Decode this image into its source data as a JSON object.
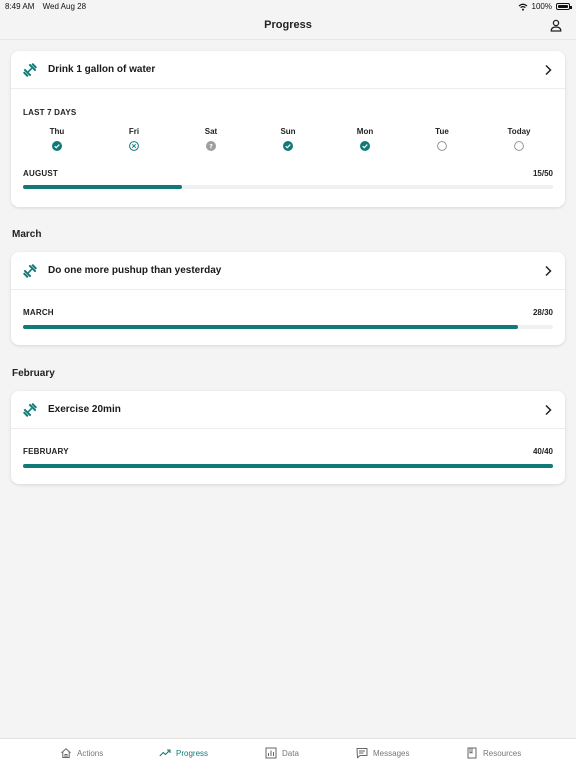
{
  "status_bar": {
    "time": "8:49 AM",
    "date": "Wed Aug 28",
    "battery": "100%"
  },
  "header": {
    "title": "Progress"
  },
  "colors": {
    "accent": "#117a78",
    "skipped": "#9e9e9e",
    "track": "#f0f0f0"
  },
  "current_goal": {
    "title": "Drink 1 gallon of water",
    "icon": "dumbbell-icon",
    "week_label": "LAST 7 DAYS",
    "days": [
      {
        "name": "Thu",
        "status": "complete"
      },
      {
        "name": "Fri",
        "status": "missed"
      },
      {
        "name": "Sat",
        "status": "skipped"
      },
      {
        "name": "Sun",
        "status": "complete"
      },
      {
        "name": "Mon",
        "status": "complete"
      },
      {
        "name": "Tue",
        "status": "pending"
      },
      {
        "name": "Today",
        "status": "pending"
      }
    ],
    "month": "AUGUST",
    "count": "15/50",
    "progress": 0.3
  },
  "sections": [
    {
      "label": "March",
      "goal": {
        "title": "Do one more pushup than yesterday",
        "icon": "dumbbell-icon",
        "month": "MARCH",
        "count": "28/30",
        "progress": 0.9333
      }
    },
    {
      "label": "February",
      "goal": {
        "title": "Exercise 20min",
        "icon": "dumbbell-icon",
        "month": "FEBRUARY",
        "count": "40/40",
        "progress": 1.0
      }
    }
  ],
  "tabs": [
    {
      "label": "Actions",
      "icon": "home-icon",
      "active": false
    },
    {
      "label": "Progress",
      "icon": "trend-icon",
      "active": true
    },
    {
      "label": "Data",
      "icon": "bar-chart-icon",
      "active": false
    },
    {
      "label": "Messages",
      "icon": "message-icon",
      "active": false
    },
    {
      "label": "Resources",
      "icon": "book-icon",
      "active": false
    }
  ]
}
